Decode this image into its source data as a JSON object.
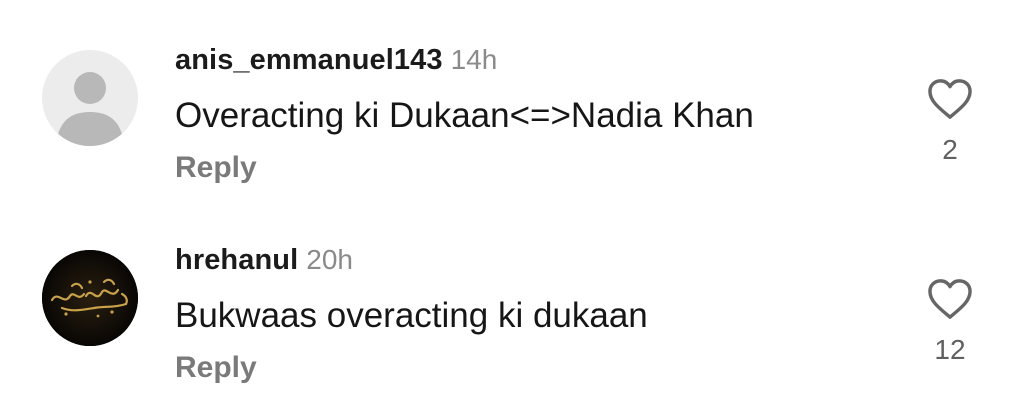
{
  "comments": [
    {
      "username": "anis_emmanuel143",
      "time": "14h",
      "text": "Overacting ki Dukaan<=>Nadia Khan",
      "reply_label": "Reply",
      "likes": "2",
      "avatar_icon": "default-person-avatar"
    },
    {
      "username": "hrehanul",
      "time": "20h",
      "text": "Bukwaas overacting ki dukaan",
      "reply_label": "Reply",
      "likes": "12",
      "avatar_icon": "gold-calligraphy-avatar"
    }
  ],
  "colors": {
    "username": "#1b1b1b",
    "timestamp": "#8a8a8a",
    "reply": "#7a7a7a",
    "heart_outline": "#666666",
    "avatar_default_bg": "#ececec",
    "avatar_art_gold": "#c9a24a"
  }
}
